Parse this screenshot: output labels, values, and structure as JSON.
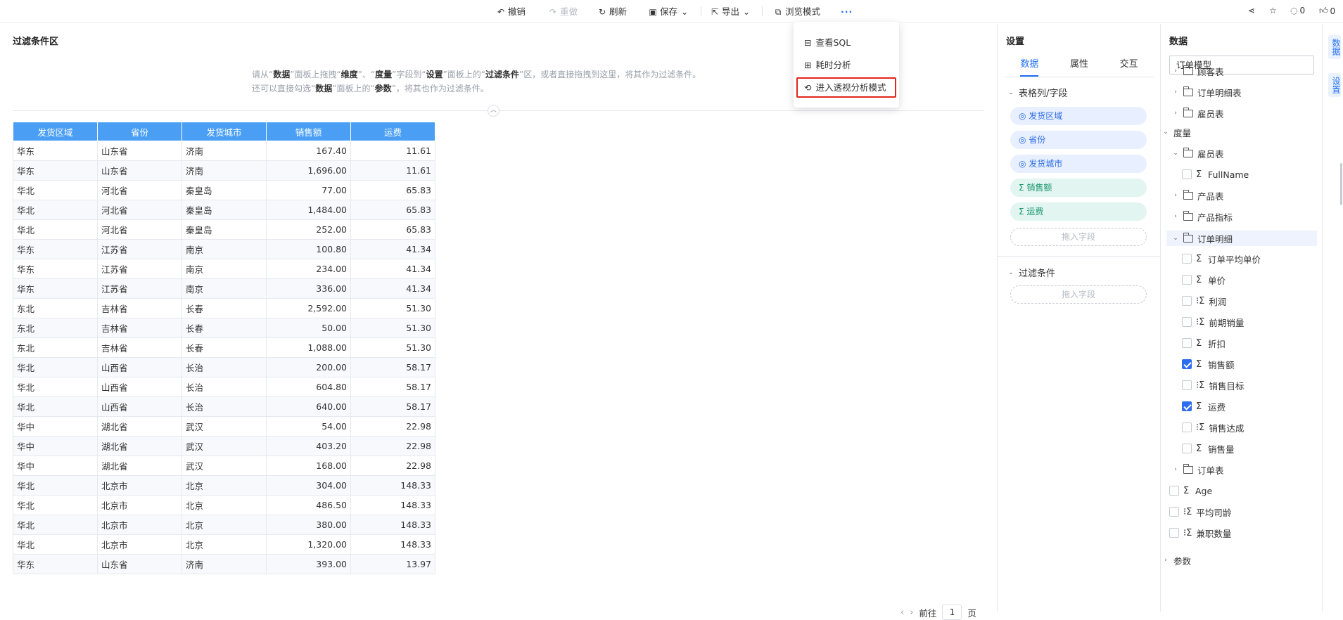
{
  "toolbar": {
    "undo": "撤销",
    "redo": "重做",
    "refresh": "刷新",
    "save": "保存",
    "export": "导出",
    "browse_mode": "浏览模式",
    "more": "···",
    "comments_count": "0",
    "likes_count": "0"
  },
  "more_menu": {
    "items": [
      "查看SQL",
      "耗时分析",
      "进入透视分析模式"
    ]
  },
  "canvas": {
    "filter_area_title": "过滤条件区",
    "hint_line1": [
      "请从“",
      "数据",
      "”面板上拖拽“",
      "维度",
      "”、“",
      "度量",
      "”字段到“",
      "设置",
      "”面板上的“",
      "过滤条件",
      "”区，或者直接拖拽到这里，将其作为过滤条件。"
    ],
    "hint_line2": [
      "还可以直接勾选“",
      "数据",
      "”面板上的“",
      "参数",
      "”，将其也作为过滤条件。"
    ]
  },
  "table": {
    "headers": [
      "发货区域",
      "省份",
      "发货城市",
      "销售额",
      "运费"
    ],
    "rows": [
      [
        "华东",
        "山东省",
        "济南",
        "167.40",
        "11.61"
      ],
      [
        "华东",
        "山东省",
        "济南",
        "1,696.00",
        "11.61"
      ],
      [
        "华北",
        "河北省",
        "秦皇岛",
        "77.00",
        "65.83"
      ],
      [
        "华北",
        "河北省",
        "秦皇岛",
        "1,484.00",
        "65.83"
      ],
      [
        "华北",
        "河北省",
        "秦皇岛",
        "252.00",
        "65.83"
      ],
      [
        "华东",
        "江苏省",
        "南京",
        "100.80",
        "41.34"
      ],
      [
        "华东",
        "江苏省",
        "南京",
        "234.00",
        "41.34"
      ],
      [
        "华东",
        "江苏省",
        "南京",
        "336.00",
        "41.34"
      ],
      [
        "东北",
        "吉林省",
        "长春",
        "2,592.00",
        "51.30"
      ],
      [
        "东北",
        "吉林省",
        "长春",
        "50.00",
        "51.30"
      ],
      [
        "东北",
        "吉林省",
        "长春",
        "1,088.00",
        "51.30"
      ],
      [
        "华北",
        "山西省",
        "长治",
        "200.00",
        "58.17"
      ],
      [
        "华北",
        "山西省",
        "长治",
        "604.80",
        "58.17"
      ],
      [
        "华北",
        "山西省",
        "长治",
        "640.00",
        "58.17"
      ],
      [
        "华中",
        "湖北省",
        "武汉",
        "54.00",
        "22.98"
      ],
      [
        "华中",
        "湖北省",
        "武汉",
        "403.20",
        "22.98"
      ],
      [
        "华中",
        "湖北省",
        "武汉",
        "168.00",
        "22.98"
      ],
      [
        "华北",
        "北京市",
        "北京",
        "304.00",
        "148.33"
      ],
      [
        "华北",
        "北京市",
        "北京",
        "486.50",
        "148.33"
      ],
      [
        "华北",
        "北京市",
        "北京",
        "380.00",
        "148.33"
      ],
      [
        "华北",
        "北京市",
        "北京",
        "1,320.00",
        "148.33"
      ],
      [
        "华东",
        "山东省",
        "济南",
        "393.00",
        "13.97"
      ]
    ]
  },
  "pager": {
    "goto_label": "前往",
    "page": "1",
    "page_suffix": "页"
  },
  "settings": {
    "title": "设置",
    "tabs": [
      "数据",
      "属性",
      "交互"
    ],
    "columns_section": "表格列/字段",
    "fields": [
      {
        "label": "发货区域",
        "kind": "dimension"
      },
      {
        "label": "省份",
        "kind": "dimension"
      },
      {
        "label": "发货城市",
        "kind": "dimension"
      },
      {
        "label": "销售额",
        "kind": "measure"
      },
      {
        "label": "运费",
        "kind": "measure"
      }
    ],
    "drop_field": "拖入字段",
    "filter_section": "过滤条件",
    "filter_drop": "拖入字段"
  },
  "data_panel": {
    "title": "数据",
    "model": "订单模型",
    "dim_tables": [
      "顾客表",
      "订单明细表",
      "雇员表"
    ],
    "measure_group": "度量",
    "employee_table": "雇员表",
    "fullname": "FullName",
    "product_table": "产品表",
    "product_metric": "产品指标",
    "order_detail": "订单明细",
    "order_detail_fields": [
      {
        "label": "订单平均单价",
        "calc": false,
        "checked": false
      },
      {
        "label": "单价",
        "calc": false,
        "checked": false
      },
      {
        "label": "利润",
        "calc": true,
        "checked": false
      },
      {
        "label": "前期销量",
        "calc": true,
        "checked": false
      },
      {
        "label": "折扣",
        "calc": false,
        "checked": false
      },
      {
        "label": "销售额",
        "calc": false,
        "checked": true
      },
      {
        "label": "销售目标",
        "calc": true,
        "checked": false
      },
      {
        "label": "运费",
        "calc": false,
        "checked": true
      },
      {
        "label": "销售达成",
        "calc": true,
        "checked": false
      },
      {
        "label": "销售量",
        "calc": false,
        "checked": false
      }
    ],
    "order_table": "订单表",
    "age": "Age",
    "avg_age": "平均司龄",
    "part_time": "兼职数量",
    "params": "参数"
  },
  "side_tabs": [
    "数据",
    "设置"
  ],
  "colors": {
    "accent": "#1f6ff2",
    "header_blue": "#4a9ff5",
    "highlight_red": "#e0261b"
  }
}
